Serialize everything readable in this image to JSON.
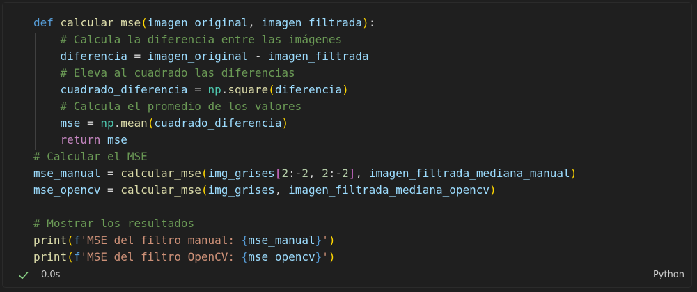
{
  "cell": {
    "code_lines": [
      "def calcular_mse(imagen_original, imagen_filtrada):",
      "    # Calcula la diferencia entre las imágenes",
      "    diferencia = imagen_original - imagen_filtrada",
      "    # Eleva al cuadrado las diferencias",
      "    cuadrado_diferencia = np.square(diferencia)",
      "    # Calcula el promedio de los valores",
      "    mse = np.mean(cuadrado_diferencia)",
      "    return mse",
      "# Calcular el MSE",
      "mse_manual = calcular_mse(img_grises[2:-2, 2:-2], imagen_filtrada_mediana_manual)",
      "mse_opencv = calcular_mse(img_grises, imagen_filtrada_mediana_opencv)",
      "",
      "# Mostrar los resultados",
      "print(f'MSE del filtro manual: {mse_manual}')",
      "print(f'MSE del filtro OpenCV: {mse_opencv}')"
    ]
  },
  "status": {
    "execution_time": "0.0s",
    "language": "Python",
    "success_icon": "check-icon",
    "success_color": "#89d185"
  }
}
